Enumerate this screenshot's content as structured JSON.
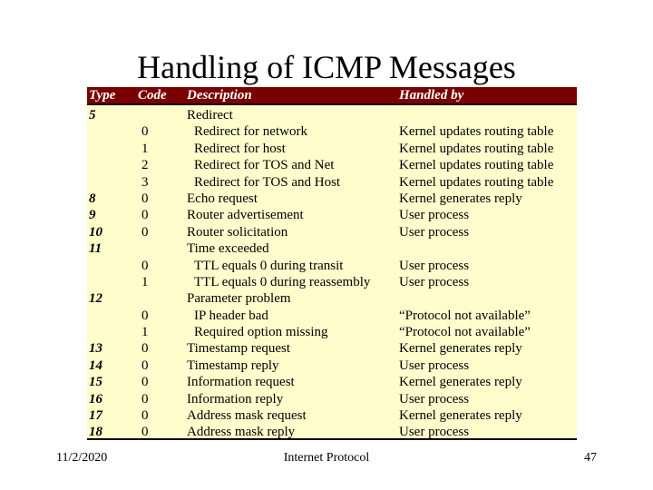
{
  "slide": {
    "title": "Handling of ICMP Messages"
  },
  "table": {
    "headers": {
      "type": "Type",
      "code": "Code",
      "description": "Description",
      "handled_by": "Handled by"
    },
    "rows": [
      {
        "type": "5",
        "code": "",
        "description": "Redirect",
        "handled_by": "",
        "sub": false
      },
      {
        "type": "",
        "code": "0",
        "description": "Redirect for network",
        "handled_by": "Kernel updates routing table",
        "sub": true
      },
      {
        "type": "",
        "code": "1",
        "description": "Redirect for host",
        "handled_by": "Kernel updates routing table",
        "sub": true
      },
      {
        "type": "",
        "code": "2",
        "description": "Redirect for TOS and Net",
        "handled_by": "Kernel updates routing table",
        "sub": true
      },
      {
        "type": "",
        "code": "3",
        "description": "Redirect for TOS and Host",
        "handled_by": "Kernel updates routing table",
        "sub": true
      },
      {
        "type": "8",
        "code": "0",
        "description": "Echo request",
        "handled_by": "Kernel generates reply",
        "sub": false
      },
      {
        "type": "9",
        "code": "0",
        "description": "Router advertisement",
        "handled_by": "User process",
        "sub": false
      },
      {
        "type": "10",
        "code": "0",
        "description": "Router solicitation",
        "handled_by": "User process",
        "sub": false
      },
      {
        "type": "11",
        "code": "",
        "description": "Time exceeded",
        "handled_by": "",
        "sub": false
      },
      {
        "type": "",
        "code": "0",
        "description": "TTL equals 0 during transit",
        "handled_by": "User process",
        "sub": true
      },
      {
        "type": "",
        "code": "1",
        "description": "TTL equals 0 during reassembly",
        "handled_by": "User process",
        "sub": true
      },
      {
        "type": "12",
        "code": "",
        "description": "Parameter problem",
        "handled_by": "",
        "sub": false
      },
      {
        "type": "",
        "code": "0",
        "description": "IP header bad",
        "handled_by": "“Protocol not available”",
        "sub": true
      },
      {
        "type": "",
        "code": "1",
        "description": "Required option missing",
        "handled_by": "“Protocol not available”",
        "sub": true
      },
      {
        "type": "13",
        "code": "0",
        "description": "Timestamp request",
        "handled_by": "Kernel generates reply",
        "sub": false
      },
      {
        "type": "14",
        "code": "0",
        "description": "Timestamp reply",
        "handled_by": "User process",
        "sub": false
      },
      {
        "type": "15",
        "code": "0",
        "description": "Information request",
        "handled_by": "Kernel generates reply",
        "sub": false
      },
      {
        "type": "16",
        "code": "0",
        "description": "Information reply",
        "handled_by": "User process",
        "sub": false
      },
      {
        "type": "17",
        "code": "0",
        "description": "Address mask request",
        "handled_by": "Kernel generates reply",
        "sub": false
      },
      {
        "type": "18",
        "code": "0",
        "description": "Address mask reply",
        "handled_by": "User process",
        "sub": false
      }
    ]
  },
  "footer": {
    "date": "11/2/2020",
    "title": "Internet Protocol",
    "page": "47"
  },
  "colors": {
    "header_bg": "#7a0000",
    "table_bg": "#fffdcc"
  }
}
